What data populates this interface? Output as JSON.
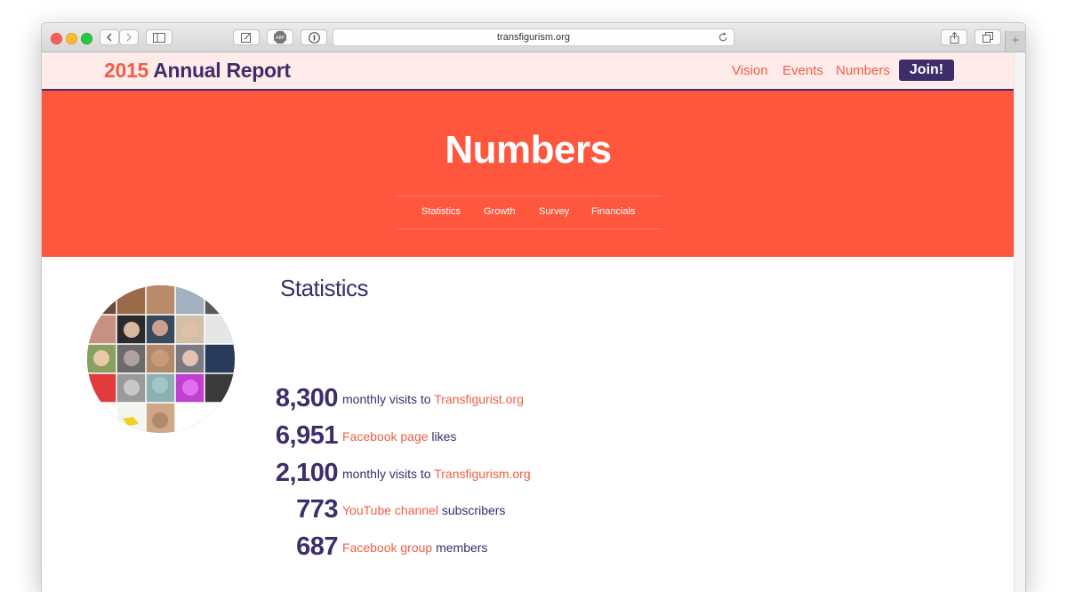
{
  "browser": {
    "url": "transfigurism.org"
  },
  "site": {
    "brand_year": "2015",
    "brand_title": "Annual Report",
    "nav": [
      {
        "label": "Vision"
      },
      {
        "label": "Events"
      },
      {
        "label": "Numbers"
      }
    ],
    "join_label": "Join!"
  },
  "hero": {
    "title": "Numbers",
    "subnav": [
      {
        "label": "Statistics"
      },
      {
        "label": "Growth"
      },
      {
        "label": "Survey"
      },
      {
        "label": "Financials"
      }
    ]
  },
  "statistics": {
    "title": "Statistics",
    "rows": [
      {
        "number": "8,300",
        "pre": "monthly visits to",
        "link": "Transfigurist.org",
        "post": ""
      },
      {
        "number": "6,951",
        "pre": "",
        "link": "Facebook page",
        "post": "likes"
      },
      {
        "number": "2,100",
        "pre": "monthly visits to",
        "link": "Transfigurism.org",
        "post": ""
      },
      {
        "number": "773",
        "pre": "",
        "link": "YouTube channel",
        "post": "subscribers"
      },
      {
        "number": "687",
        "pre": "",
        "link": "Facebook group",
        "post": "members"
      }
    ]
  },
  "colors": {
    "brand_purple": "#3d2d6b",
    "accent_red": "#f15d45",
    "hero_red": "#ff563e",
    "navbar_pink": "#ffecea"
  }
}
